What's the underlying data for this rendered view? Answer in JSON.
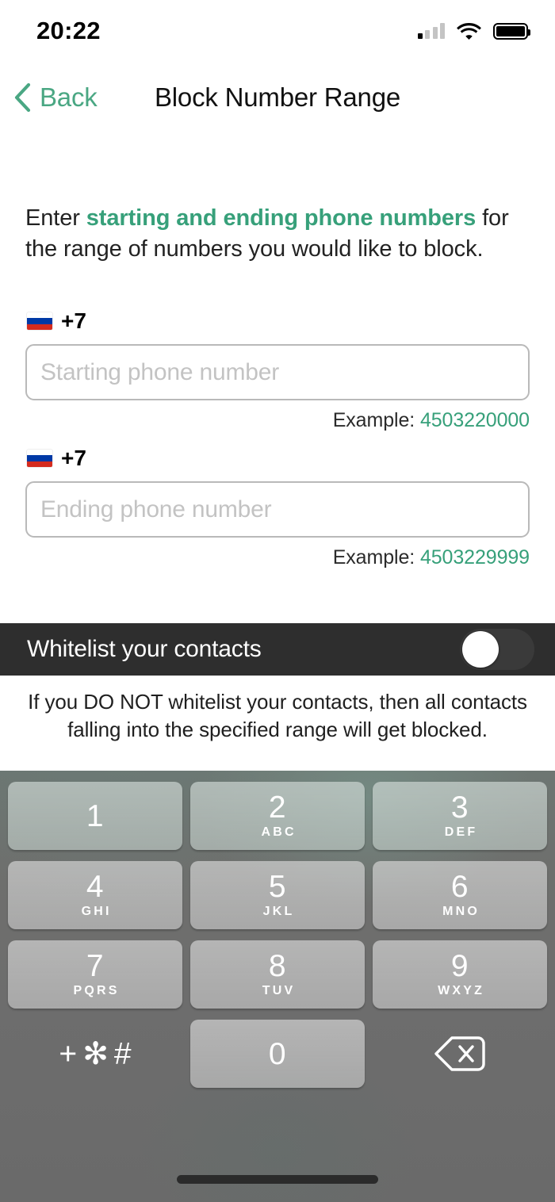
{
  "status_bar": {
    "time": "20:22",
    "icons": [
      "cellular-signal",
      "wifi",
      "battery"
    ]
  },
  "nav": {
    "back_label": "Back",
    "back_icon": "chevron-left-icon",
    "title": "Block Number Range",
    "accent_color": "#4aa783"
  },
  "intro": {
    "text_before": "Enter ",
    "highlight": "starting and ending phone numbers",
    "text_after": " for the range of numbers you would like to block.",
    "highlight_color": "#37a07a"
  },
  "fields": [
    {
      "flag_icon": "russia-flag-icon",
      "country_code": "+7",
      "placeholder": "Starting phone number",
      "value": "",
      "example_label": "Example: ",
      "example_value": "4503220000"
    },
    {
      "flag_icon": "russia-flag-icon",
      "country_code": "+7",
      "placeholder": "Ending phone number",
      "value": "",
      "example_label": "Example: ",
      "example_value": "4503229999"
    }
  ],
  "whitelist": {
    "label": "Whitelist your contacts",
    "toggle_state": "off",
    "note": "If you DO NOT whitelist your contacts, then all contacts falling into the specified range will get blocked.",
    "bar_background": "#2e2e2e"
  },
  "keypad": {
    "keys": [
      {
        "digit": "1",
        "letters": ""
      },
      {
        "digit": "2",
        "letters": "ABC"
      },
      {
        "digit": "3",
        "letters": "DEF"
      },
      {
        "digit": "4",
        "letters": "GHI"
      },
      {
        "digit": "5",
        "letters": "JKL"
      },
      {
        "digit": "6",
        "letters": "MNO"
      },
      {
        "digit": "7",
        "letters": "PQRS"
      },
      {
        "digit": "8",
        "letters": "TUV"
      },
      {
        "digit": "9",
        "letters": "WXYZ"
      }
    ],
    "symbols_key": "+✻#",
    "zero_key": "0",
    "backspace_icon": "backspace-icon"
  }
}
